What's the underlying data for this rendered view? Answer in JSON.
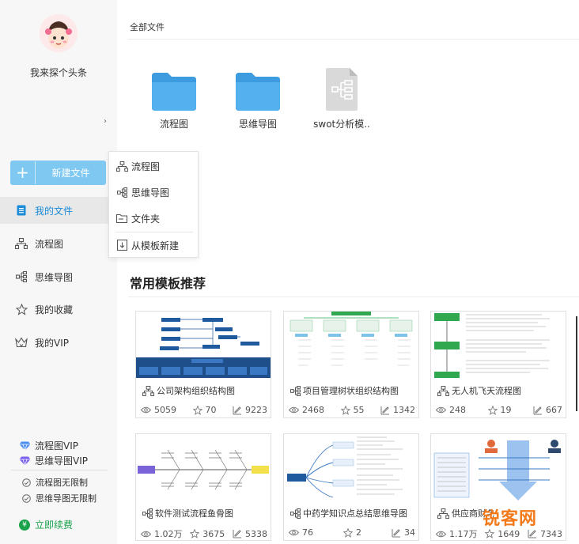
{
  "user": {
    "name": "我来探个头条"
  },
  "sidebar": {
    "new_button": "新建文件",
    "nav": [
      {
        "label": "我的文件",
        "icon": "document-icon",
        "active": true
      },
      {
        "label": "流程图",
        "icon": "flowchart-icon",
        "active": false
      },
      {
        "label": "思维导图",
        "icon": "mindmap-icon",
        "active": false
      },
      {
        "label": "我的收藏",
        "icon": "star-icon",
        "active": false
      },
      {
        "label": "我的VIP",
        "icon": "crown-icon",
        "active": false
      }
    ],
    "vip": [
      {
        "label": "流程图VIP",
        "color": "#4b8ef0"
      },
      {
        "label": "思维导图VIP",
        "color": "#7a5ff0"
      }
    ],
    "limits": [
      "流程图无限制",
      "思维导图无限制"
    ],
    "renew": "立即续费"
  },
  "dropdown": {
    "items": [
      "流程图",
      "思维导图",
      "文件夹",
      "从模板新建"
    ]
  },
  "main": {
    "breadcrumb": "全部文件",
    "files": [
      {
        "name": "流程图",
        "type": "folder"
      },
      {
        "name": "思维导图",
        "type": "folder"
      },
      {
        "name": "swot分析模..",
        "type": "document"
      }
    ],
    "section_title": "常用模板推荐",
    "templates": [
      {
        "title": "公司架构组织结构图",
        "type": "flowchart",
        "views": "5059",
        "stars": "70",
        "uses": "9223"
      },
      {
        "title": "项目管理树状组织结构图",
        "type": "mindmap",
        "views": "2468",
        "stars": "55",
        "uses": "1342"
      },
      {
        "title": "无人机飞天流程图",
        "type": "flowchart",
        "views": "248",
        "stars": "19",
        "uses": "667"
      },
      {
        "title": "软件测试流程鱼骨图",
        "type": "mindmap",
        "views": "1.02万",
        "stars": "3675",
        "uses": "5338"
      },
      {
        "title": "中药学知识点总结思维导图",
        "type": "mindmap",
        "views": "76",
        "stars": "2",
        "uses": "34"
      },
      {
        "title": "供应商财务",
        "type": "flowchart",
        "views": "1.17万",
        "stars": "1649",
        "uses": "7343"
      }
    ]
  },
  "watermark": "锐客网",
  "colors": {
    "accent": "#1a8cd8",
    "button": "#7ec8f2",
    "folder": "#4fa8e8",
    "renew": "#1aa34a"
  }
}
